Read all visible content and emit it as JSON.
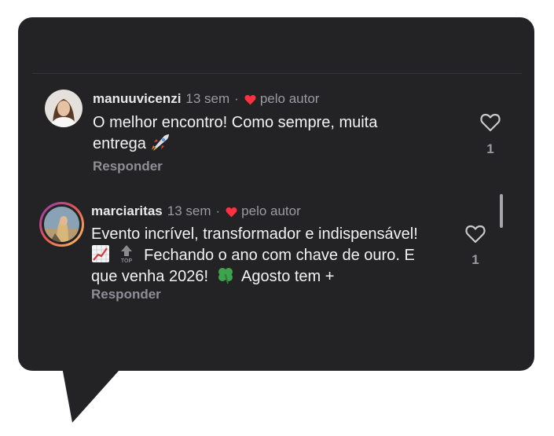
{
  "comments": [
    {
      "username": "manuuvicenzi",
      "time": "13 sem",
      "separator": "·",
      "liked_by_author_label": "pelo autor",
      "text_line1": "O melhor encontro! Como sempre, muita",
      "text_line2": "entrega",
      "text_emojis": [
        "rocket"
      ],
      "reply_label": "Responder",
      "like_count": "1"
    },
    {
      "username": "marciaritas",
      "time": "13 sem",
      "separator": "·",
      "liked_by_author_label": "pelo autor",
      "text_line1": "Evento incrível, transformador e indispensável!",
      "text_line2": "Fechando o ano com chave de ouro. E",
      "text_line3": "que venha 2026!",
      "text_line3b": "Agosto tem +",
      "text_emojis": [
        "chart-increasing",
        "top-arrow",
        "four-leaf-clover"
      ],
      "reply_label": "Responder",
      "like_count": "1"
    }
  ],
  "colors": {
    "panel": "#232326",
    "heart_red": "#ff3040",
    "text": "#f2f2f3",
    "muted": "#9a9aa0"
  }
}
